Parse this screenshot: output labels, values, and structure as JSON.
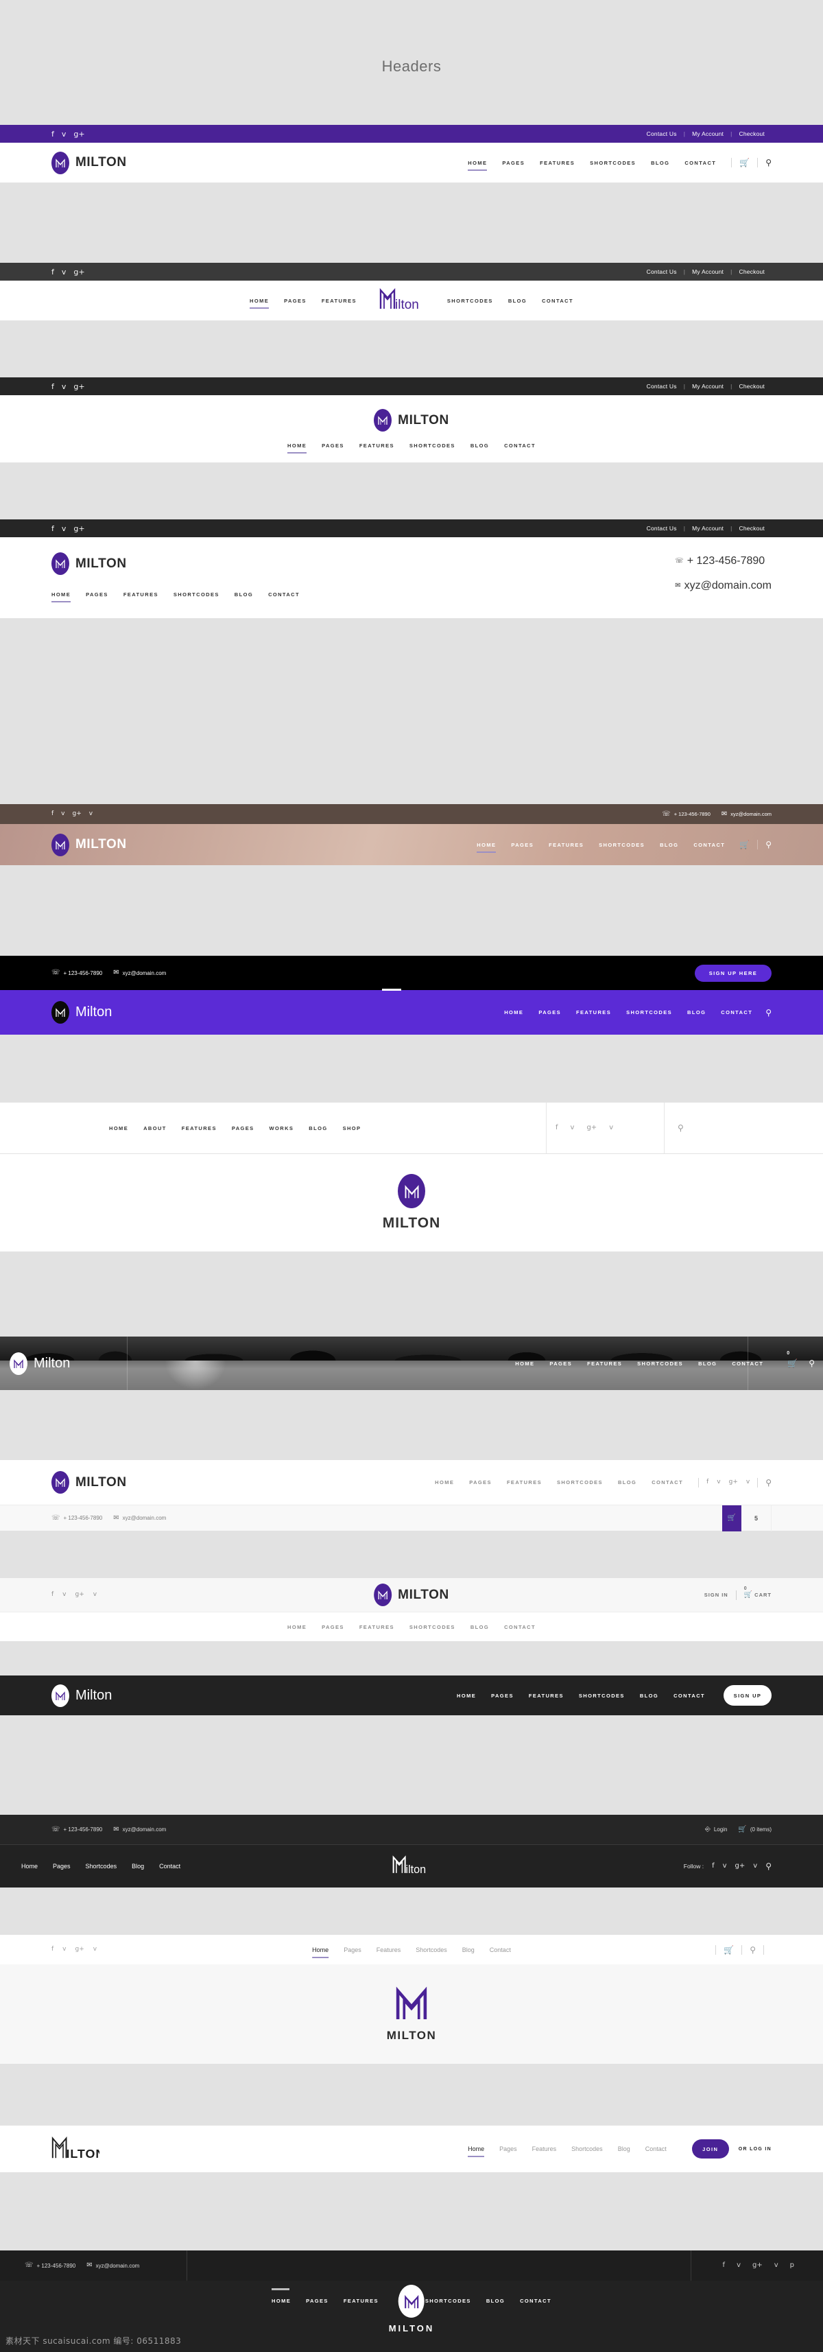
{
  "page": {
    "title": "Headers",
    "brand": "MILTON",
    "brand_mixed": "Milton"
  },
  "colors": {
    "purple": "#4a2296",
    "purple_bright": "#5b2bd6",
    "dark": "#2b2b2b",
    "darker": "#1e1e1e",
    "black": "#000000",
    "page_bg": "#e2e2e2",
    "accent_underline": "#9b8fc4"
  },
  "icons": {
    "facebook": "f",
    "twitter": "ᴠ",
    "google_plus": "g+",
    "vimeo": "v",
    "pinterest": "p",
    "search": "search-icon",
    "cart": "cart-icon",
    "phone": "phone-icon",
    "mail": "mail-icon"
  },
  "contact": {
    "phone": "+ 123-456-7890",
    "email": "xyz@domain.com"
  },
  "top_links": {
    "contact_us": "Contact Us",
    "my_account": "My Account",
    "checkout": "Checkout"
  },
  "nav_main": [
    "HOME",
    "PAGES",
    "FEATURES",
    "SHORTCODES",
    "BLOG",
    "CONTACT"
  ],
  "nav_main_cap": [
    "Home",
    "Pages",
    "Features",
    "Shortcodes",
    "Blog",
    "Contact"
  ],
  "nav_short": [
    "Home",
    "Pages",
    "Shortcodes",
    "Blog",
    "Contact"
  ],
  "nav_left_split": [
    "HOME",
    "PAGES",
    "FEATURES"
  ],
  "nav_right_split": [
    "SHORTCODES",
    "BLOG",
    "CONTACT"
  ],
  "nav_shop": [
    "HOME",
    "ABOUT",
    "FEATURES",
    "PAGES",
    "WORKS",
    "BLOG",
    "SHOP"
  ],
  "buttons": {
    "sign_up_here": "SIGN UP HERE",
    "sign_up": "SIGN UP",
    "join": "JOIN",
    "or_log_in": "OR LOG IN",
    "sign_in": "SIGN IN",
    "cart_label": "CART",
    "login": "Login",
    "cart_items": "(0 items)",
    "follow": "Follow :"
  },
  "counts": {
    "cart_badge": "0",
    "cart_qty": "5"
  },
  "watermark": "素材天下 sucaisucai.com 编号: 06511883",
  "headers": [
    {
      "id": "h1",
      "name": "purple-topbar-left-logo"
    },
    {
      "id": "h2",
      "name": "dark-topbar-centered-logo"
    },
    {
      "id": "h3",
      "name": "dark-topbar-stacked-centered"
    },
    {
      "id": "h4",
      "name": "dark-topbar-logo-contact"
    },
    {
      "id": "h5",
      "name": "image-bg-transparent"
    },
    {
      "id": "h6",
      "name": "black-bar-purple-nav"
    },
    {
      "id": "h7",
      "name": "split-nav-social-search"
    },
    {
      "id": "h8",
      "name": "centered-stacked-logo"
    },
    {
      "id": "h9",
      "name": "photo-overlay-nav"
    },
    {
      "id": "h10",
      "name": "logo-nav-social-cart-bar"
    },
    {
      "id": "h11",
      "name": "light-bar-signin-cart"
    },
    {
      "id": "h12",
      "name": "dark-nav-signup"
    },
    {
      "id": "h13",
      "name": "dark-topbar-centered-follow"
    },
    {
      "id": "h14",
      "name": "light-nav-cart-search"
    },
    {
      "id": "h15",
      "name": "centered-big-logo"
    },
    {
      "id": "h16",
      "name": "white-nav-join"
    },
    {
      "id": "h17",
      "name": "dark-contact-social-split"
    },
    {
      "id": "h18",
      "name": "dark-centered-split-nav"
    }
  ]
}
